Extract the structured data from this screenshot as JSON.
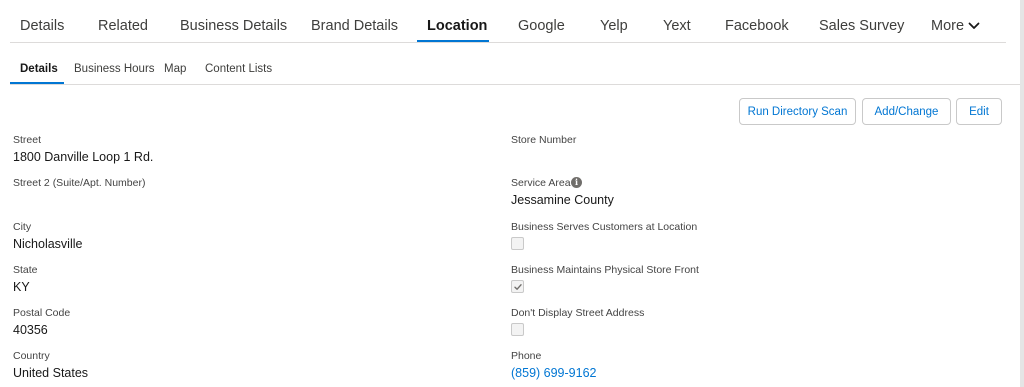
{
  "top_tabs": [
    "Details",
    "Related",
    "Business Details",
    "Brand Details",
    "Location",
    "Google",
    "Yelp",
    "Yext",
    "Facebook",
    "Sales Survey",
    "More"
  ],
  "active_top_tab": "Location",
  "sub_tabs": [
    "Details",
    "Business Hours",
    "Map",
    "Content Lists"
  ],
  "active_sub_tab": "Details",
  "actions": {
    "run_directory_scan": "Run Directory Scan",
    "add_change": "Add/Change",
    "edit": "Edit"
  },
  "left_fields": {
    "street": {
      "label": "Street",
      "value": "1800 Danville Loop 1 Rd."
    },
    "street2": {
      "label": "Street 2 (Suite/Apt. Number)",
      "value": ""
    },
    "city": {
      "label": "City",
      "value": "Nicholasville"
    },
    "state": {
      "label": "State",
      "value": "KY"
    },
    "postal_code": {
      "label": "Postal Code",
      "value": "40356"
    },
    "country": {
      "label": "Country",
      "value": "United States"
    }
  },
  "right_fields": {
    "store_number": {
      "label": "Store Number",
      "value": ""
    },
    "service_area": {
      "label": "Service Area",
      "value": "Jessamine County"
    },
    "serves_at_location": {
      "label": "Business Serves Customers at Location",
      "checked": false
    },
    "physical_store_front": {
      "label": "Business Maintains Physical Store Front",
      "checked": true
    },
    "hide_street_address": {
      "label": "Don't Display Street Address",
      "checked": false
    },
    "phone": {
      "label": "Phone",
      "value": "(859) 699-9162"
    }
  },
  "colors": {
    "accent": "#0176d3",
    "text": "#181818",
    "muted": "#444444",
    "border": "#dddbda"
  }
}
